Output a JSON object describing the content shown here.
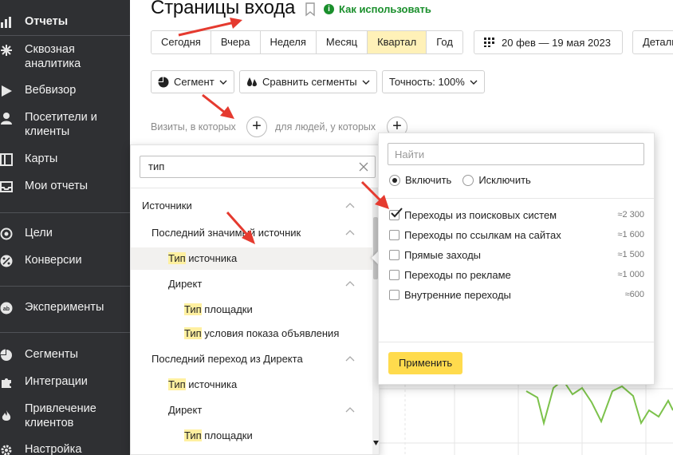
{
  "sidebar": {
    "items": [
      {
        "label": "Отчеты",
        "icon": "bar-chart-icon"
      },
      {
        "label": "Сквозная аналитика",
        "icon": "asterisk-icon"
      },
      {
        "label": "Вебвизор",
        "icon": "play-icon"
      },
      {
        "label": "Посетители и клиенты",
        "icon": "user-icon"
      },
      {
        "label": "Карты",
        "icon": "map-icon"
      },
      {
        "label": "Мои отчеты",
        "icon": "inbox-icon"
      },
      {
        "label": "Цели",
        "icon": "target-icon"
      },
      {
        "label": "Конверсии",
        "icon": "percent-icon"
      },
      {
        "label": "Эксперименты",
        "icon": "ab-icon"
      },
      {
        "label": "Сегменты",
        "icon": "pie-icon"
      },
      {
        "label": "Интеграции",
        "icon": "puzzle-icon"
      },
      {
        "label": "Привлечение клиентов",
        "icon": "flame-icon"
      },
      {
        "label": "Настройка",
        "icon": "gear-icon"
      }
    ]
  },
  "header": {
    "title": "Страницы входа",
    "howto": "Как использовать",
    "info_glyph": "i"
  },
  "periods": [
    "Сегодня",
    "Вчера",
    "Неделя",
    "Месяц",
    "Квартал",
    "Год"
  ],
  "active_period": "Квартал",
  "daterange": "20 фев — 19 мая 2023",
  "details_label": "Детали",
  "controls": {
    "segment": "Сегмент",
    "compare": "Сравнить сегменты",
    "accuracy": "Точность: 100%"
  },
  "filter": {
    "visits_label": "Визиты, в которых",
    "people_label": "для людей, у которых",
    "plus": "+"
  },
  "left_panel": {
    "search_value": "тип",
    "rows": [
      {
        "pre": "",
        "hl": "",
        "post": "Источники"
      },
      {
        "pre": "",
        "hl": "",
        "post": "Последний значимый источник"
      },
      {
        "pre": "",
        "hl": "Тип",
        "post": " источника"
      },
      {
        "pre": "",
        "hl": "",
        "post": "Директ"
      },
      {
        "pre": "",
        "hl": "Тип",
        "post": " площадки"
      },
      {
        "pre": "",
        "hl": "Тип",
        "post": " условия показа объявления"
      },
      {
        "pre": "",
        "hl": "",
        "post": "Последний переход из Директа"
      },
      {
        "pre": "",
        "hl": "Тип",
        "post": " источника"
      },
      {
        "pre": "",
        "hl": "",
        "post": "Директ"
      },
      {
        "pre": "",
        "hl": "Тип",
        "post": " площадки"
      }
    ]
  },
  "right_panel": {
    "find_placeholder": "Найти",
    "include": "Включить",
    "exclude": "Исключить",
    "options": [
      {
        "label": "Переходы из поисковых систем",
        "count": "≈2 300",
        "checked": true
      },
      {
        "label": "Переходы по ссылкам на сайтах",
        "count": "≈1 600",
        "checked": false
      },
      {
        "label": "Прямые заходы",
        "count": "≈1 500",
        "checked": false
      },
      {
        "label": "Переходы по рекламе",
        "count": "≈1 000",
        "checked": false
      },
      {
        "label": "Внутренние переходы",
        "count": "≈600",
        "checked": false
      }
    ],
    "apply": "Применить"
  },
  "colors": {
    "sidebar_bg": "#2f3033",
    "active_period": "#fff1b8",
    "highlight": "#fff0a0",
    "apply_button": "#ffdb4d",
    "accent_green": "#1a8f2c",
    "annotation_red": "#e53a2f",
    "chart_line": "#7cc24b"
  }
}
